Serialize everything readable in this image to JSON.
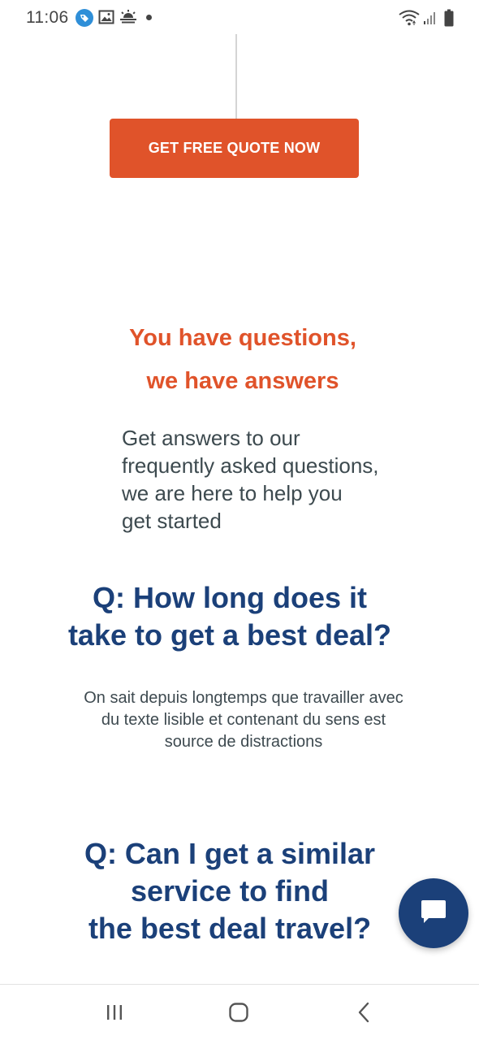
{
  "status_bar": {
    "time": "11:06",
    "left_icons": [
      "tag-notification-icon",
      "gallery-icon",
      "weather-icon",
      "dot-icon"
    ],
    "right_icons": [
      "wifi-icon",
      "signal-icon",
      "battery-icon"
    ]
  },
  "cta": {
    "label": "GET FREE QUOTE NOW"
  },
  "faq_section": {
    "headline_line1": "You have questions,",
    "headline_line2": "we have answers",
    "subtitle_lines": [
      "Get answers to our",
      "frequently asked questions,",
      "we are here to help you",
      "get started"
    ],
    "questions": [
      {
        "question_lines": [
          "Q: How long does it",
          "take to get a best deal?"
        ],
        "answer_lines": [
          "On sait depuis longtemps que travailler avec",
          "du texte lisible et contenant du sens est",
          "source de distractions"
        ]
      },
      {
        "question_lines": [
          "Q: Can I get a similar",
          "service to find",
          "the best deal travel?"
        ]
      }
    ]
  },
  "chat": {
    "icon": "chat-bubble-icon"
  },
  "nav_bar": {
    "icons": [
      "recent-apps-icon",
      "home-icon",
      "back-icon"
    ]
  },
  "colors": {
    "accent_orange": "#e0532a",
    "navy": "#1b4079",
    "body_text": "#3d4a4f"
  }
}
